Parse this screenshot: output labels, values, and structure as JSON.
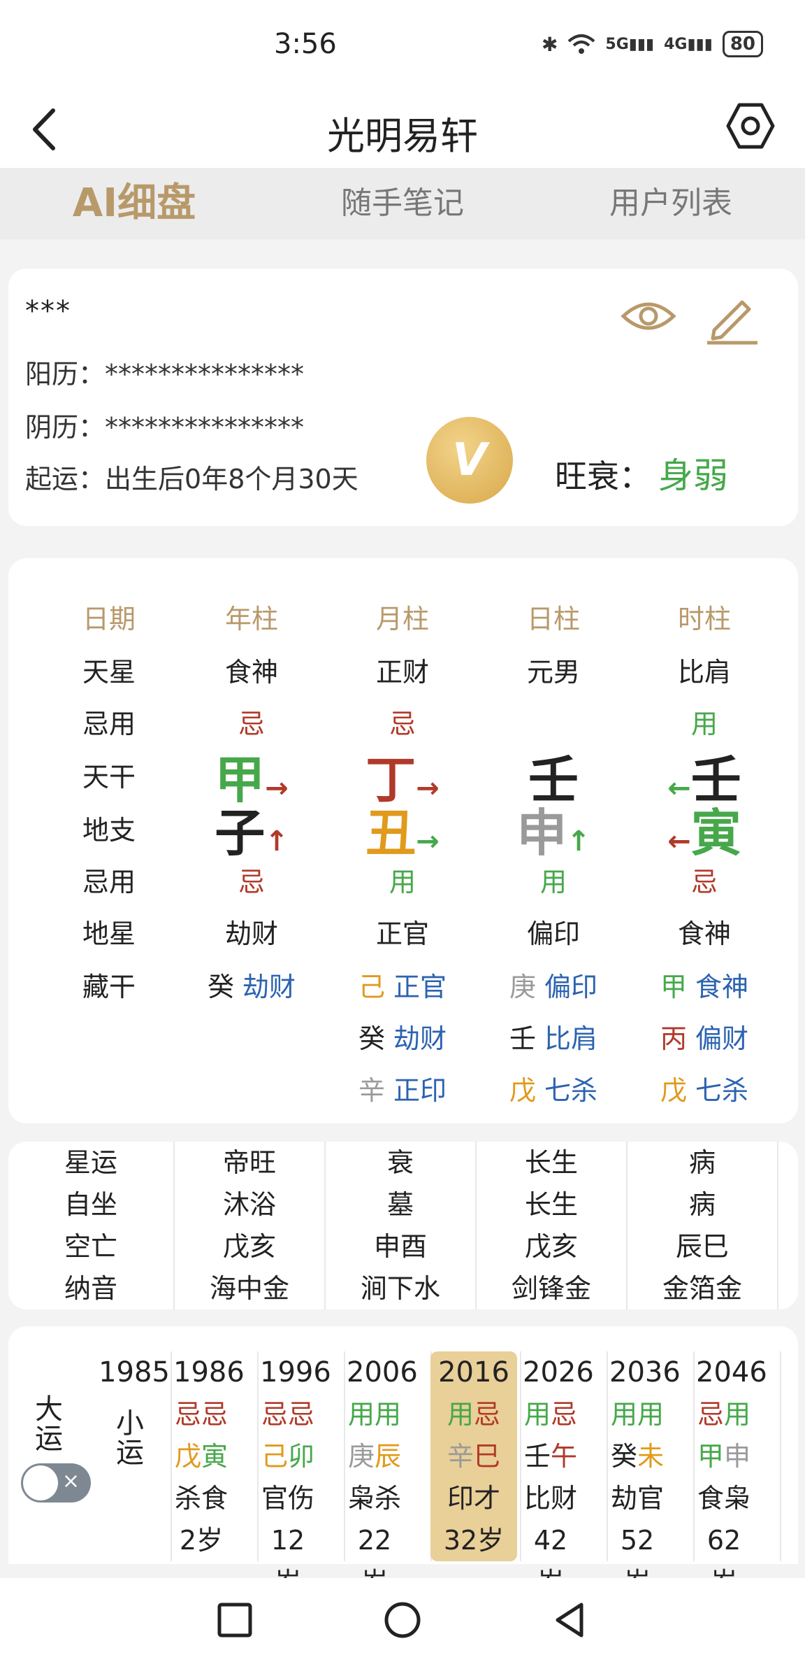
{
  "status": {
    "time": "3:56",
    "bt": "✱",
    "wifi": "WiFi",
    "sig1": "5G",
    "sig2": "4G",
    "battery": "80"
  },
  "header": {
    "title": "光明易轩"
  },
  "tabs": [
    {
      "label": "AI细盘"
    },
    {
      "label": "随手笔记"
    },
    {
      "label": "用户列表"
    }
  ],
  "info": {
    "name": "***",
    "solar_label": "阳历：",
    "solar_value": "***************",
    "lunar_label": "阴历：",
    "lunar_value": "***************",
    "qiyun_label": "起运：",
    "qiyun_value": "出生后0年8个月30天",
    "vip": "V",
    "wangshuai_label": "旺衰：",
    "wangshuai_value": "身弱"
  },
  "pillars": {
    "row_labels": [
      "日期",
      "天星",
      "忌用",
      "天干",
      "地支",
      "忌用",
      "地星",
      "藏干"
    ],
    "columns": [
      {
        "header": "年柱",
        "tianxing": "食神",
        "jiyong1": "忌",
        "gan": "甲",
        "gan_arrow": "→",
        "zhi": "子",
        "zhi_arrow": "↑",
        "jiyong2": "忌",
        "dixing": "劫财",
        "canggan": [
          {
            "g": "癸",
            "s": "劫财"
          }
        ]
      },
      {
        "header": "月柱",
        "tianxing": "正财",
        "jiyong1": "忌",
        "gan": "丁",
        "gan_arrow": "→",
        "zhi": "丑",
        "zhi_arrow": "→",
        "jiyong2": "用",
        "dixing": "正官",
        "canggan": [
          {
            "g": "己",
            "s": "正官"
          },
          {
            "g": "癸",
            "s": "劫财"
          },
          {
            "g": "辛",
            "s": "正印"
          }
        ]
      },
      {
        "header": "日柱",
        "tianxing": "元男",
        "jiyong1": "",
        "gan": "壬",
        "gan_arrow": "",
        "zhi": "申",
        "zhi_arrow": "↑",
        "jiyong2": "用",
        "dixing": "偏印",
        "canggan": [
          {
            "g": "庚",
            "s": "偏印"
          },
          {
            "g": "壬",
            "s": "比肩"
          },
          {
            "g": "戊",
            "s": "七杀"
          }
        ]
      },
      {
        "header": "时柱",
        "tianxing": "比肩",
        "jiyong1": "用",
        "gan": "壬",
        "gan_arrow": "←",
        "zhi": "寅",
        "zhi_arrow": "←",
        "jiyong2": "忌",
        "dixing": "食神",
        "canggan": [
          {
            "g": "甲",
            "s": "食神"
          },
          {
            "g": "丙",
            "s": "偏财"
          },
          {
            "g": "戊",
            "s": "七杀"
          }
        ]
      }
    ]
  },
  "stars": {
    "labels": [
      "星运",
      "自坐",
      "空亡",
      "纳音"
    ],
    "columns": [
      [
        "帝旺",
        "沐浴",
        "戊亥",
        "海中金"
      ],
      [
        "衰",
        "墓",
        "申酉",
        "涧下水"
      ],
      [
        "长生",
        "长生",
        "戊亥",
        "剑锋金"
      ],
      [
        "病",
        "病",
        "辰巳",
        "金箔金"
      ]
    ]
  },
  "dayun": {
    "label_dayun": "大运",
    "label_xiaoyun": "小运",
    "toggle_x": "×",
    "first_year": "1985",
    "columns": [
      {
        "year": "1986",
        "jy": [
          "忌",
          "忌"
        ],
        "gz": [
          "戊",
          "寅"
        ],
        "ss": "杀食",
        "age": "2岁"
      },
      {
        "year": "1996",
        "jy": [
          "忌",
          "忌"
        ],
        "gz": [
          "己",
          "卯"
        ],
        "ss": "官伤",
        "age": "12岁"
      },
      {
        "year": "2006",
        "jy": [
          "用",
          "用"
        ],
        "gz": [
          "庚",
          "辰"
        ],
        "ss": "枭杀",
        "age": "22岁"
      },
      {
        "year": "2016",
        "jy": [
          "用",
          "忌"
        ],
        "gz": [
          "辛",
          "巳"
        ],
        "ss": "印才",
        "age": "32岁"
      },
      {
        "year": "2026",
        "jy": [
          "用",
          "忌"
        ],
        "gz": [
          "壬",
          "午"
        ],
        "ss": "比财",
        "age": "42岁"
      },
      {
        "year": "2036",
        "jy": [
          "用",
          "用"
        ],
        "gz": [
          "癸",
          "未"
        ],
        "ss": "劫官",
        "age": "52岁"
      },
      {
        "year": "2046",
        "jy": [
          "忌",
          "用"
        ],
        "gz": [
          "甲",
          "申"
        ],
        "ss": "食枭",
        "age": "62岁"
      }
    ]
  },
  "colors": {
    "accent": "#b8996a",
    "green": "#46a84a",
    "red": "#b03a2a",
    "orange": "#e09a1c",
    "blue": "#2c63b0",
    "grey": "#9a9a9a",
    "selected": "#e9cf98"
  }
}
